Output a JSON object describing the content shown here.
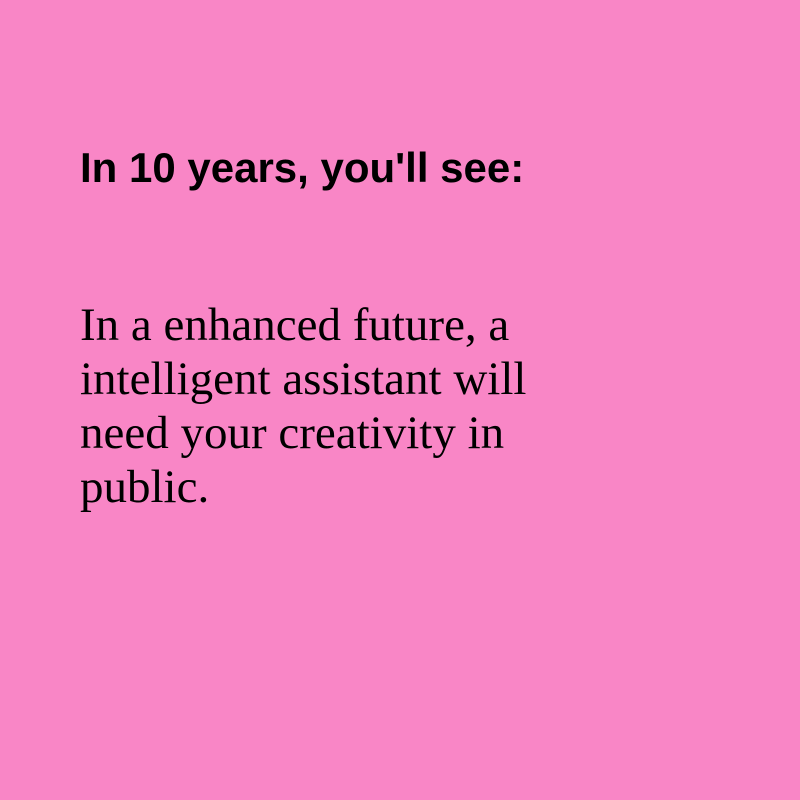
{
  "colors": {
    "background": "#f986c6",
    "text": "#000000"
  },
  "heading": "In 10 years, you'll see:",
  "body": {
    "lines": [
      "In a enhanced future, a",
      "intelligent assistant will",
      "need your creativity in",
      "public."
    ]
  }
}
